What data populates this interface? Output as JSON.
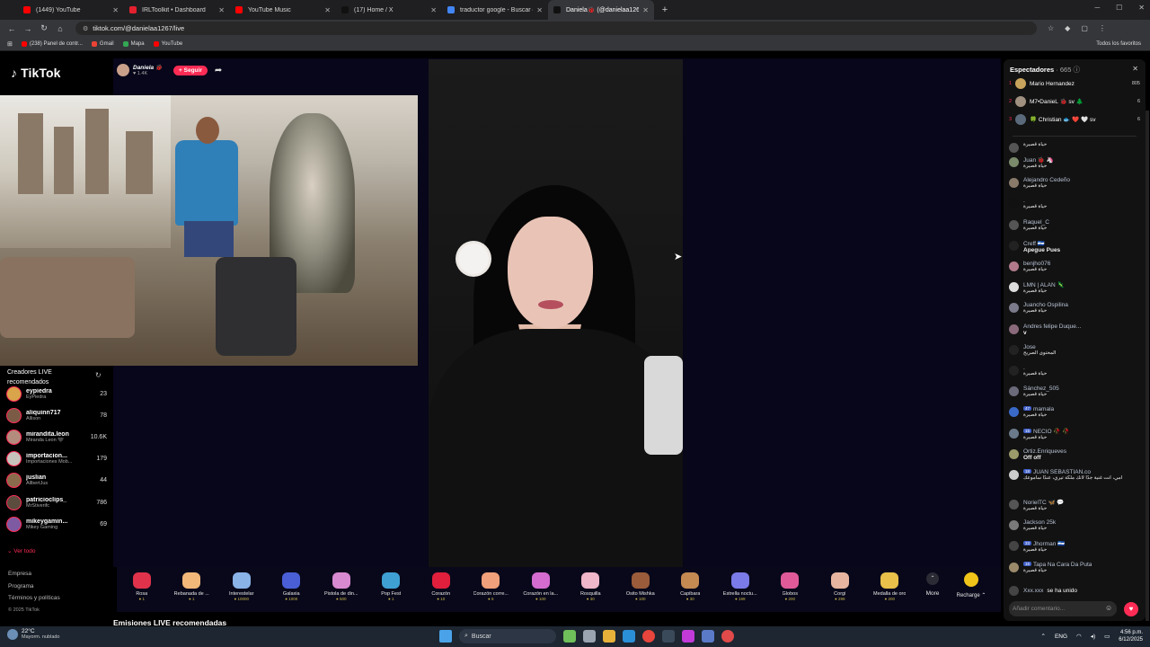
{
  "browser": {
    "tabs": [
      {
        "title": "(1449) YouTube",
        "color": "#ff0000",
        "active": false
      },
      {
        "title": "IRLToolkit • Dashboard",
        "color": "#e5202e",
        "active": false
      },
      {
        "title": "YouTube Music",
        "color": "#ff0000",
        "active": false
      },
      {
        "title": "(17) Home / X",
        "color": "#111111",
        "active": false
      },
      {
        "title": "traductor google - Buscar con Google",
        "color": "#4285f4",
        "active": false
      },
      {
        "title": "Daniela🐞 (@danielaa1267)",
        "color": "#111111",
        "active": true
      }
    ],
    "url": "tiktok.com/@danielaa1267/live",
    "bookmarks": [
      {
        "label": "(238) Panel de contr...",
        "color": "#ff0000"
      },
      {
        "label": "Gmail",
        "color": "#ea4335"
      },
      {
        "label": "Mapa",
        "color": "#34a853"
      },
      {
        "label": "YouTube",
        "color": "#ff0000"
      }
    ],
    "all_favorites": "Todos los favoritos"
  },
  "tiktok": {
    "logo": "TikTok",
    "host_name": "Daniela 🐞",
    "host_likes": "♥ 1.4K",
    "follow_label": "+ Seguir",
    "recommended_title": "Creadores LIVE recomendados",
    "creators": [
      {
        "handle": "eypiedra",
        "name": "EyPiedra",
        "count": "23",
        "color": "#d9a44a"
      },
      {
        "handle": "aliquinn717",
        "name": "Allison",
        "count": "78",
        "color": "#7b5b46"
      },
      {
        "handle": "mirandita.leon",
        "name": "Miranda Leon 🖤",
        "count": "10.6K",
        "color": "#b48c7e"
      },
      {
        "handle": "importacion...",
        "name": "Importaciones Mob...",
        "count": "179",
        "color": "#c8c2bd"
      },
      {
        "handle": "juslian",
        "name": "AllbertJus",
        "count": "44",
        "color": "#8a6b4c"
      },
      {
        "handle": "patricioclips_",
        "name": "MrStiverifc",
        "count": "786",
        "color": "#5c4c3e"
      },
      {
        "handle": "mikeygamin...",
        "name": "Mikey Gaming",
        "count": "69",
        "color": "#7e5aa2"
      }
    ],
    "ver_todo": "Ver todo",
    "footer_links": [
      "Empresa",
      "Programa",
      "Términos y políticas"
    ],
    "copyright": "© 2025 TikTok",
    "emisiones": "Emisiones LIVE recomendadas",
    "gifts": [
      {
        "name": "Rosa",
        "price": "1",
        "color": "#e0334b"
      },
      {
        "name": "Rebanada de ...",
        "price": "1",
        "color": "#f2b879"
      },
      {
        "name": "Interestelar",
        "price": "10000",
        "color": "#8ab3e8"
      },
      {
        "name": "Galaxia",
        "price": "1000",
        "color": "#4a5fd6"
      },
      {
        "name": "Pistola de din...",
        "price": "500",
        "color": "#d88ad0"
      },
      {
        "name": "Pop Fest",
        "price": "1",
        "color": "#3fa0d4"
      },
      {
        "name": "Corazón",
        "price": "10",
        "color": "#e01f3c"
      },
      {
        "name": "Corazón corre...",
        "price": "5",
        "color": "#f0a07a"
      },
      {
        "name": "Corazón en la...",
        "price": "100",
        "color": "#d46cd0"
      },
      {
        "name": "Rosquilla",
        "price": "30",
        "color": "#f0b6c9"
      },
      {
        "name": "Osito Mishka",
        "price": "100",
        "color": "#9a5c3a"
      },
      {
        "name": "Capibara",
        "price": "30",
        "color": "#c48a52"
      },
      {
        "name": "Estrella noctu...",
        "price": "199",
        "color": "#7a7ae8"
      },
      {
        "name": "Globos",
        "price": "200",
        "color": "#e05a9a"
      },
      {
        "name": "Corgi",
        "price": "299",
        "color": "#e8b6a0"
      },
      {
        "name": "Medalla de oro",
        "price": "200",
        "color": "#e8c04a"
      }
    ],
    "more_label": "More",
    "recharge_label": "Recharge ⌃"
  },
  "chat": {
    "title": "Espectadores",
    "viewers_count": "· 665",
    "top_viewers": [
      {
        "rank": "1",
        "name": "Mario Hernandez",
        "score": "805",
        "color": "#c7a35c"
      },
      {
        "rank": "2",
        "name": "M7•DanieL 🐞 sv 🌲",
        "score": "6",
        "color": "#a09080"
      },
      {
        "rank": "3",
        "name": "🍀 Christian 🐟 ❤️ 🤍 sv",
        "score": "6",
        "color": "#5a6a7a"
      }
    ],
    "messages": [
      {
        "user": "",
        "text": "حياة قصيرة",
        "color": "#555"
      },
      {
        "user": "Juan 🐞 🦄",
        "text": "حياة قصيرة",
        "color": "#7a8a6a"
      },
      {
        "user": "Alejandro Cedeño",
        "text": "حياة قصيرة",
        "color": "#8a7a6a"
      },
      {
        "user": ".",
        "text": "حياة قصيرة",
        "color": "#111"
      },
      {
        "user": "Raquel_C",
        "text": "حياة قصيرة",
        "color": "#555"
      },
      {
        "user": "Creff 🇸🇻",
        "text": "Apegue Pues",
        "color": "#222",
        "big": true
      },
      {
        "user": "benjho076",
        "text": "حياة قصيرة",
        "color": "#b07a8a"
      },
      {
        "user": "LMN | ALAN 🦎",
        "text": "حياة قصيرة",
        "color": "#ddd"
      },
      {
        "user": "Juancho Ospilina",
        "text": "حياة قصيرة",
        "color": "#7a7a8a"
      },
      {
        "user": "Andres felipe Duque...",
        "text": "v",
        "color": "#8a6a7a",
        "big": true
      },
      {
        "user": "Jose",
        "text": "المحتوى الصريح",
        "color": "#222"
      },
      {
        "user": ".",
        "text": "حياة قصيرة",
        "color": "#222"
      },
      {
        "user": "Sánchez_505",
        "text": "حياة قصيرة",
        "color": "#6a6a7a"
      },
      {
        "user": "mamala",
        "badge": "47",
        "text": "حياة قصيرة",
        "color": "#3a6ac8"
      },
      {
        "user": "NECIO 🥀 🥀",
        "badge": "15",
        "text": "حياة قصيرة",
        "color": "#6a7a8a"
      },
      {
        "user": "Ortiz.Enriqueves",
        "text": "Off off",
        "color": "#9a9a6a",
        "big": true
      },
      {
        "user": "JUAN SEBASTIAN.co",
        "badge": "18",
        "text": "امي، انت غنية جدًا لأنك ملكة تيري، عندًا سأموعك",
        "color": "#ccc"
      },
      {
        "user": "NorielTC 🦋 💬",
        "text": "حياة قصيرة",
        "color": "#555"
      },
      {
        "user": "Jackson 25k",
        "text": "حياة قصيرة",
        "color": "#7a7a7a"
      },
      {
        "user": "Jhorman 🇸🇻",
        "badge": "33",
        "text": "حياة قصيرة",
        "color": "#444"
      },
      {
        "user": "Tapa Na Cara Da Puta",
        "badge": "16",
        "text": "حياة قصيرة",
        "color": "#9a8a6a"
      }
    ],
    "joined_user": "Xxx.xxx",
    "joined_text": "se ha unido",
    "comment_placeholder": "Añadir comentario..."
  },
  "taskbar": {
    "temperature": "22°C",
    "weather": "Mayorm. nublado",
    "search": "Buscar",
    "lang": "ENG",
    "time": "4:56 p.m.",
    "date": "6/12/2025"
  }
}
